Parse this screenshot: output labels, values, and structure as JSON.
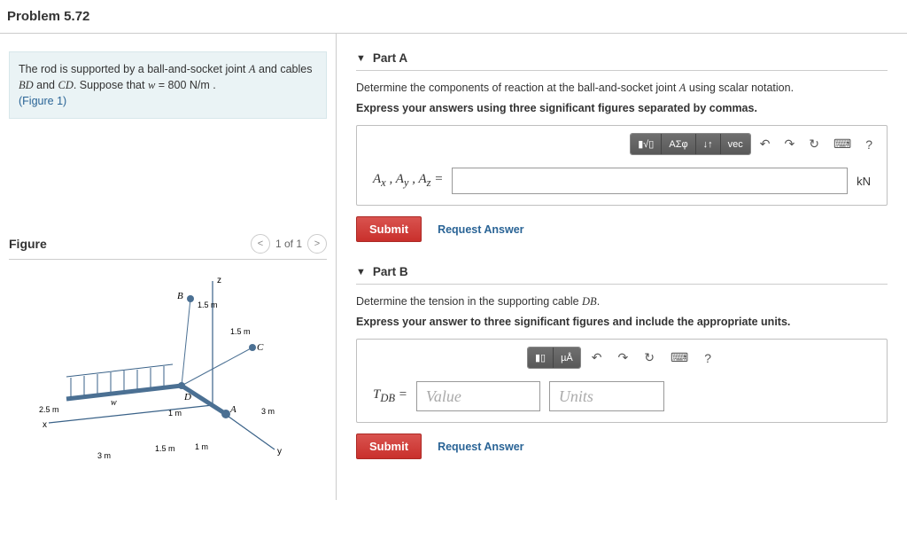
{
  "header": {
    "title": "Problem 5.72"
  },
  "problem": {
    "text_pre": "The rod is supported by a ball-and-socket joint ",
    "jointA": "A",
    "text_mid": " and cables ",
    "BD": "BD",
    "and": " and ",
    "CD": "CD",
    "suppose": ". Suppose that ",
    "w": "w",
    "eq": " = 800  N/m .",
    "figure_link": "(Figure 1)"
  },
  "figure": {
    "heading": "Figure",
    "pager": "1 of 1",
    "labels": {
      "z": "z",
      "x": "x",
      "y": "y",
      "B": "B",
      "C": "C",
      "D": "D",
      "A": "A",
      "w": "w",
      "m15a": "1.5 m",
      "m15b": "1.5 m",
      "m15c": "1.5 m",
      "m1a": "1 m",
      "m1b": "1 m",
      "m25": "2.5 m",
      "m3a": "3 m",
      "m3b": "3 m"
    }
  },
  "partA": {
    "title": "Part A",
    "prompt_pre": "Determine the components of reaction at the ball-and-socket joint ",
    "jointA": "A",
    "prompt_post": " using scalar notation.",
    "instruct": "Express your answers using three significant figures separated by commas.",
    "toolbar": {
      "b1": "▮√▯",
      "b2": "ΑΣφ",
      "b3": "↓↑",
      "b4": "vec",
      "undo": "↶",
      "redo": "↷",
      "reset": "↻",
      "kbd": "⌨",
      "help": "?"
    },
    "varlabel_html": "A<sub>x</sub> , A<sub>y</sub> , A<sub>z</sub>  =",
    "unit": "kN",
    "submit": "Submit",
    "request": "Request Answer"
  },
  "partB": {
    "title": "Part B",
    "prompt_pre": "Determine the tension in the supporting cable ",
    "DB": "DB",
    "prompt_post": ".",
    "instruct": "Express your answer to three significant figures and include the appropriate units.",
    "toolbar": {
      "b1": "▮▯",
      "b2": "µÅ",
      "undo": "↶",
      "redo": "↷",
      "reset": "↻",
      "kbd": "⌨",
      "help": "?"
    },
    "varlabel_html": "T<sub>DB</sub>  =",
    "value_ph": "Value",
    "units_ph": "Units",
    "submit": "Submit",
    "request": "Request Answer"
  }
}
